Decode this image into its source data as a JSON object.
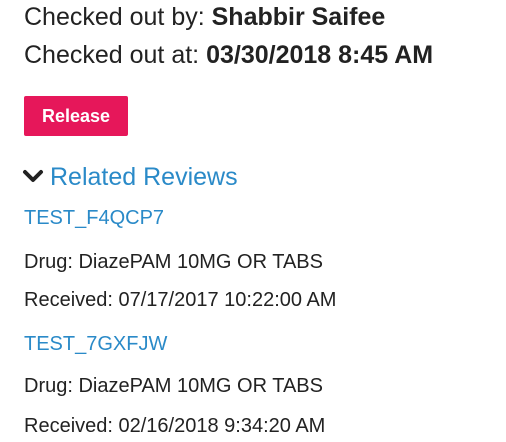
{
  "checkout": {
    "by_label": "Checked out by:",
    "by_value": "Shabbir Saifee",
    "at_label": "Checked out at:",
    "at_value": "03/30/2018 8:45 AM"
  },
  "release_button": {
    "label": "Release",
    "color": "#e6175a"
  },
  "related_reviews": {
    "title": "Related Reviews",
    "toggle_icon": "chevron-down-icon",
    "link_color": "#2a8ac8",
    "items": [
      {
        "id": "TEST_F4QCP7",
        "drug": "Drug: DiazePAM 10MG OR TABS",
        "received": "Received: 07/17/2017 10:22:00 AM"
      },
      {
        "id": "TEST_7GXFJW",
        "drug": "Drug: DiazePAM 10MG OR TABS",
        "received": "Received: 02/16/2018 9:34:20 AM"
      }
    ]
  }
}
